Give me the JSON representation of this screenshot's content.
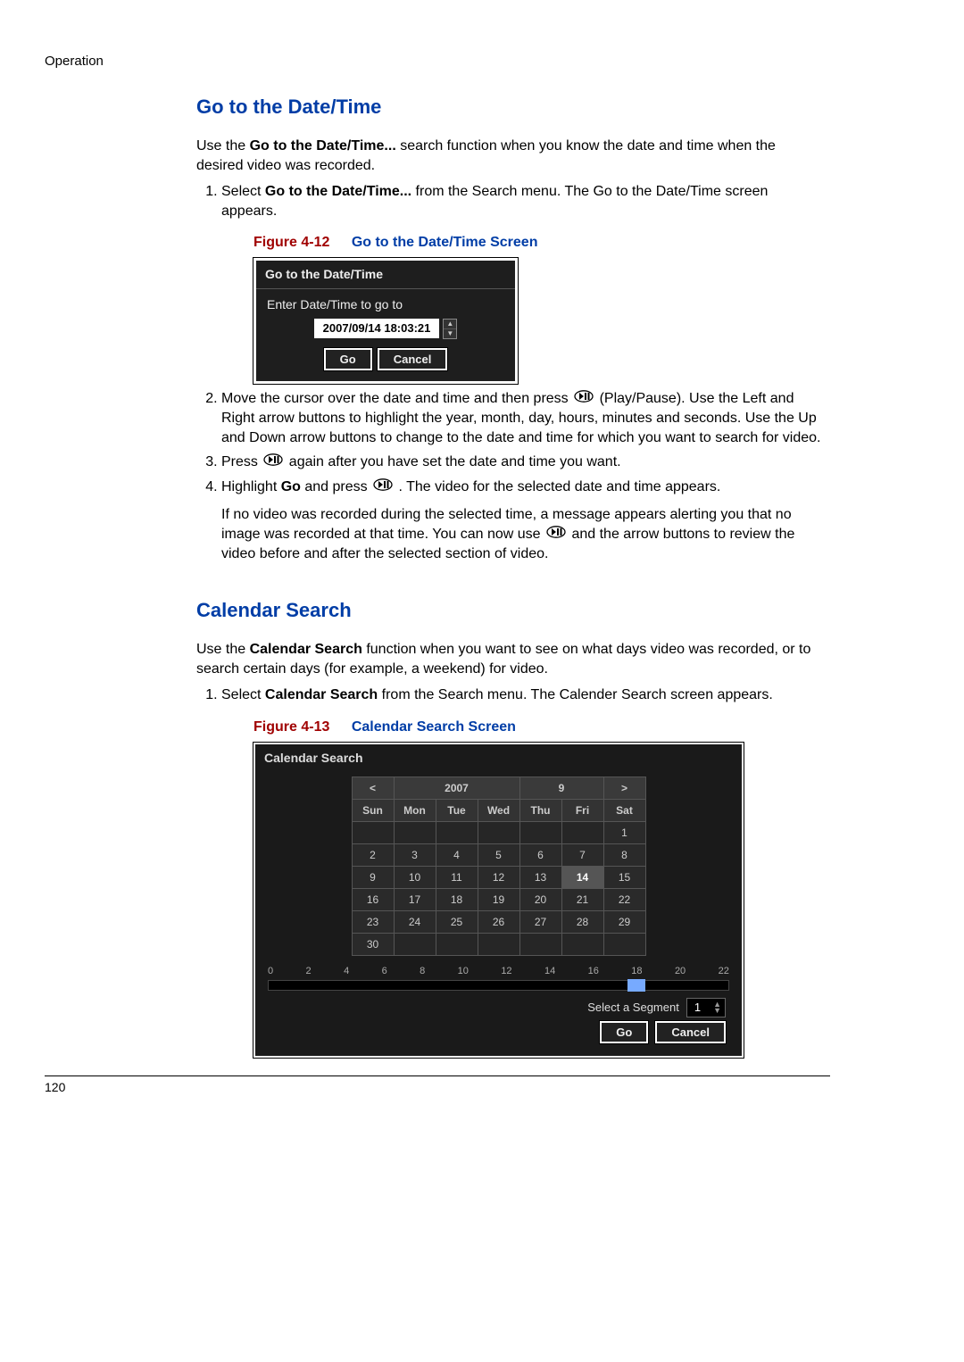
{
  "header": "Operation",
  "pageNumber": "120",
  "section1": {
    "title": "Go to the Date/Time",
    "intro_a": "Use the ",
    "intro_bold": "Go to the Date/Time...",
    "intro_b": " search function when you know the date and time when the desired video was recorded.",
    "step1_a": "Select ",
    "step1_bold": "Go to the Date/Time...",
    "step1_b": " from the Search menu. The Go to the Date/Time screen appears.",
    "figcaption_num": "Figure 4-12",
    "figcaption_title": "Go to the Date/Time Screen",
    "dialog": {
      "title": "Go to the Date/Time",
      "label": "Enter Date/Time to go to",
      "value": "2007/09/14  18:03:21",
      "go": "Go",
      "cancel": "Cancel"
    },
    "step2": "Move the cursor over the date and time and then press ",
    "step2_after": " (Play/Pause). Use the Left and Right arrow buttons to highlight the year, month, day, hours, minutes and seconds. Use the Up and Down arrow buttons to change to the date and time for which you want to search for video.",
    "step3_a": "Press ",
    "step3_b": " again after you have set the date and time you want.",
    "step4_a": "Highlight ",
    "step4_bold": "Go",
    "step4_b": " and press ",
    "step4_c": ". The video for the selected date and time appears.",
    "after4_a": "If no video was recorded during the selected time, a message appears alerting you that no image was recorded at that time. You can now use ",
    "after4_b": " and the arrow buttons to review the video before and after the selected section of video."
  },
  "section2": {
    "title": "Calendar Search",
    "intro_a": "Use the ",
    "intro_bold": "Calendar Search",
    "intro_b": " function when you want to see on what days video was recorded, or to search certain days (for example, a weekend) for video.",
    "step1_a": "Select ",
    "step1_bold": "Calendar Search",
    "step1_b": " from the Search menu. The Calender Search screen appears.",
    "figcaption_num": "Figure 4-13",
    "figcaption_title": "Calendar Search Screen",
    "calendar": {
      "title": "Calendar Search",
      "prev": "<",
      "next": ">",
      "year": "2007",
      "month": "9",
      "days": [
        "Sun",
        "Mon",
        "Tue",
        "Wed",
        "Thu",
        "Fri",
        "Sat"
      ],
      "grid": [
        [
          "",
          "",
          "",
          "",
          "",
          "",
          "1"
        ],
        [
          "2",
          "3",
          "4",
          "5",
          "6",
          "7",
          "8"
        ],
        [
          "9",
          "10",
          "11",
          "12",
          "13",
          "14",
          "15"
        ],
        [
          "16",
          "17",
          "18",
          "19",
          "20",
          "21",
          "22"
        ],
        [
          "23",
          "24",
          "25",
          "26",
          "27",
          "28",
          "29"
        ],
        [
          "30",
          "",
          "",
          "",
          "",
          "",
          ""
        ]
      ],
      "highlight": "14",
      "ticks": [
        "0",
        "2",
        "4",
        "6",
        "8",
        "10",
        "12",
        "14",
        "16",
        "18",
        "20",
        "22"
      ],
      "seg_label": "Select a Segment",
      "seg_val": "1",
      "go": "Go",
      "cancel": "Cancel"
    }
  }
}
